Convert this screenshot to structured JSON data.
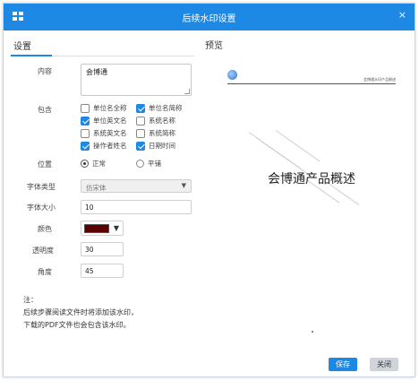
{
  "dialog": {
    "title": "后续水印设置",
    "close_glyph": "×"
  },
  "tabs": {
    "settings": "设置",
    "preview": "预览"
  },
  "form": {
    "content_label": "内容",
    "content_value": "会博通",
    "include_label": "包含",
    "options": [
      {
        "label": "单位名全称",
        "checked": false
      },
      {
        "label": "单位名简称",
        "checked": true
      },
      {
        "label": "单位英文名",
        "checked": true
      },
      {
        "label": "系统名称",
        "checked": false
      },
      {
        "label": "系统英文名",
        "checked": false
      },
      {
        "label": "系统简称",
        "checked": false
      },
      {
        "label": "操作者姓名",
        "checked": true
      },
      {
        "label": "日期时间",
        "checked": true
      }
    ],
    "position_label": "位置",
    "position_options": [
      {
        "label": "正常",
        "selected": true
      },
      {
        "label": "平铺",
        "selected": false
      }
    ],
    "font_label": "字体类型",
    "font_value": "仿宋体",
    "size_label": "字体大小",
    "size_value": "10",
    "color_label": "颜色",
    "color_value": "#5a0000",
    "opacity_label": "透明度",
    "opacity_value": "30",
    "angle_label": "角度",
    "angle_value": "45"
  },
  "note": {
    "heading": "注：",
    "line1": "后续步骤阅读文件时将添加该水印，",
    "line2": "下载的PDF文件也会包含该水印。"
  },
  "preview": {
    "header_text": "会博通水印产品概述",
    "doc_title": "会博通产品概述"
  },
  "buttons": {
    "save": "保存",
    "close": "关闭"
  },
  "colors": {
    "accent": "#1e88e5",
    "swatch": "#5a0000"
  }
}
